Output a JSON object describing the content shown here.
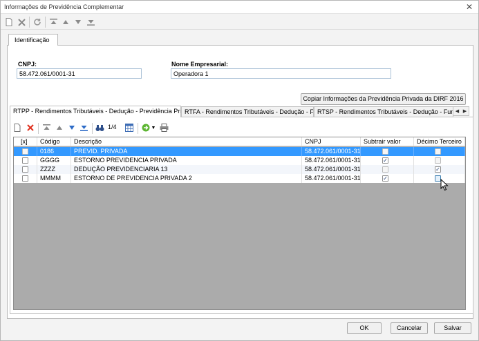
{
  "window": {
    "title": "Informações de Previdência Complementar",
    "close_label": "✕"
  },
  "toolbar": {
    "icons": [
      "new-icon",
      "delete-icon",
      "refresh-icon",
      "first-icon",
      "up-icon",
      "down-icon",
      "last-icon"
    ]
  },
  "ident_tab": {
    "label": "Identificação"
  },
  "cnpj": {
    "label": "CNPJ:",
    "value": "58.472.061/0001-31"
  },
  "nome": {
    "label": "Nome Empresarial:",
    "value": "Operadora 1"
  },
  "copy_button": {
    "label": "Copiar Informações da Previdência Privada da DIRF 2016"
  },
  "inner_tabs": [
    {
      "label": "RTPP - Rendimentos Tributáveis - Dedução - Previdência Privada"
    },
    {
      "label": "RTFA - Rendimentos Tributáveis - Dedução - FAPI"
    },
    {
      "label": "RTSP - Rendimentos Tributáveis - Dedução - Fundo de"
    }
  ],
  "grid_toolbar": {
    "page_counter": "1/4"
  },
  "grid": {
    "headers": [
      "[x]",
      "Código",
      "Descrição",
      "CNPJ",
      "Subtrair valor",
      "Décimo Terceiro"
    ],
    "rows": [
      {
        "codigo": "0186",
        "descricao": "PREVID. PRIVADA",
        "cnpj": "58.472.061/0001-31",
        "subtrair": false,
        "decimo": false,
        "selected": true
      },
      {
        "codigo": "GGGG",
        "descricao": "ESTORNO PREVIDENCIA PRIVADA",
        "cnpj": "58.472.061/0001-31",
        "subtrair": true,
        "decimo": false,
        "selected": false
      },
      {
        "codigo": "ZZZZ",
        "descricao": "DEDUÇÃO PREVIDENCIARIA 13",
        "cnpj": "58.472.061/0001-31",
        "subtrair": false,
        "decimo": true,
        "selected": false
      },
      {
        "codigo": "MMMM",
        "descricao": "ESTORNO DE PREVIDENCIA PRIVADA 2",
        "cnpj": "58.472.061/0001-31",
        "subtrair": true,
        "decimo": false,
        "selected": false
      }
    ]
  },
  "footer": {
    "ok": "OK",
    "cancel": "Cancelar",
    "save": "Salvar"
  },
  "colors": {
    "selection": "#3399ff",
    "grid_background": "#ababab"
  }
}
